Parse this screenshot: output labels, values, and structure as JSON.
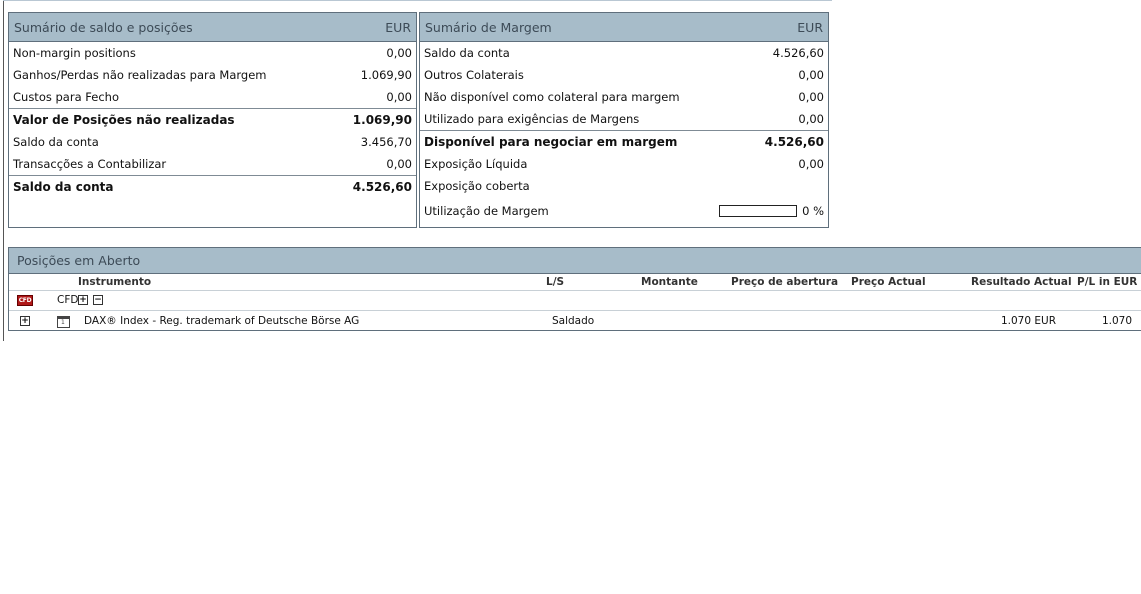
{
  "balance_summary": {
    "title": "Sumário de saldo e posições",
    "currency": "EUR",
    "rows": [
      {
        "label": "Non-margin positions",
        "value": "0,00"
      },
      {
        "label": "Ganhos/Perdas não realizadas para Margem",
        "value": "1.069,90"
      },
      {
        "label": "Custos para Fecho",
        "value": "0,00"
      },
      {
        "label": "Valor de Posições não realizadas",
        "value": "1.069,90"
      },
      {
        "label": "Saldo da conta",
        "value": "3.456,70"
      },
      {
        "label": "Transacções a Contabilizar",
        "value": "0,00"
      },
      {
        "label": "Saldo da conta",
        "value": "4.526,60"
      }
    ]
  },
  "margin_summary": {
    "title": "Sumário de Margem",
    "currency": "EUR",
    "rows": [
      {
        "label": "Saldo da conta",
        "value": "4.526,60"
      },
      {
        "label": "Outros Colaterais",
        "value": "0,00"
      },
      {
        "label": "Não disponível como colateral para margem",
        "value": "0,00"
      },
      {
        "label": "Utilizado para exigências de Margens",
        "value": "0,00"
      },
      {
        "label": "Disponível para negociar em margem",
        "value": "4.526,60"
      },
      {
        "label": "Exposição Líquida",
        "value": "0,00"
      },
      {
        "label": "Exposição coberta",
        "value": ""
      }
    ],
    "utilization": {
      "label": "Utilização de Margem",
      "value_text": "0 %",
      "fraction": 0
    }
  },
  "open_positions": {
    "title": "Posições em Aberto",
    "columns": {
      "instrument": "Instrumento",
      "ls": "L/S",
      "amount": "Montante",
      "open_price": "Preço de abertura",
      "current_price": "Preço Actual",
      "current_result": "Resultado Actual",
      "pl": "P/L in EUR"
    },
    "group": {
      "icon_text": "CFD",
      "label": "CFD",
      "expand": "+",
      "collapse": "−"
    },
    "rows": [
      {
        "expand": "+",
        "instrument": "DAX® Index - Reg. trademark of Deutsche Börse AG",
        "ls": "Saldado",
        "current_result": "1.070 EUR",
        "pl": "1.070"
      }
    ]
  }
}
